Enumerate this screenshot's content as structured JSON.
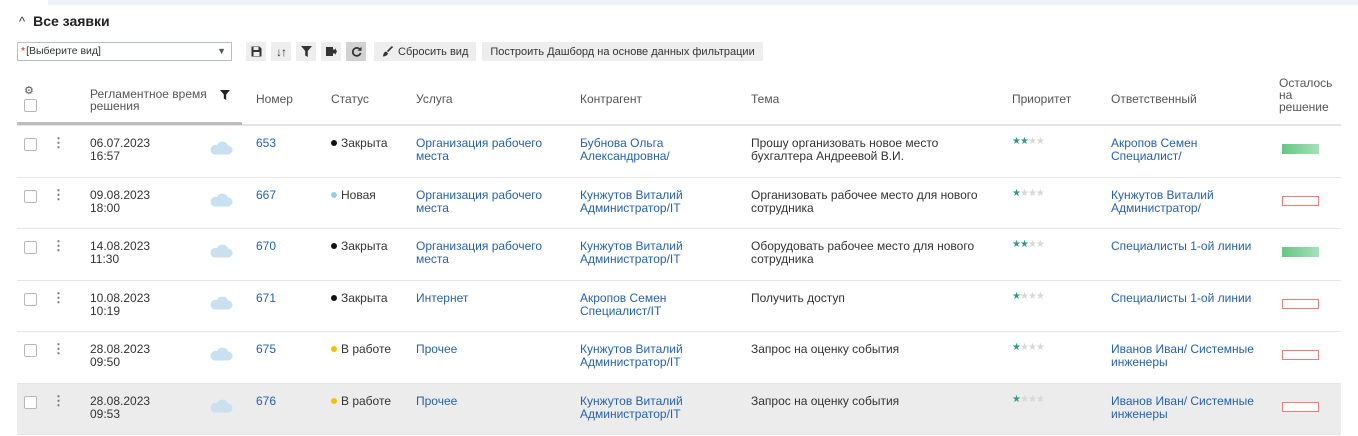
{
  "section": {
    "title": "Все заявки",
    "collapse_icon": "chevron-up"
  },
  "toolbar": {
    "view_select": {
      "required_mark": "*",
      "value": "[Выберите вид]"
    },
    "icons": [
      "save-icon",
      "sort-icon",
      "filter-icon",
      "export-icon",
      "refresh-icon"
    ],
    "reset_view_label": "Сбросить вид",
    "dashboard_label": "Построить Дашборд на основе данных фильтрации"
  },
  "columns": {
    "settings_icon": "gear-icon",
    "deadline": "Регламентное время решения",
    "number": "Номер",
    "status": "Статус",
    "service": "Услуга",
    "counterparty": "Контрагент",
    "subject": "Тема",
    "priority": "Приоритет",
    "responsible": "Ответственный",
    "remaining": "Осталось на решение"
  },
  "rows": [
    {
      "date": "06.07.2023",
      "time": "16:57",
      "number": "653",
      "status": "Закрыта",
      "status_color": "#111111",
      "service": "Организация рабочего места",
      "counterparty": "Бубнова Ольга Александровна/",
      "subject": "Прошу организовать новое место бухгалтера Андреевой В.И.",
      "priority": 2,
      "responsible": "Акропов Семен Специалист/",
      "remaining": "ok"
    },
    {
      "date": "09.08.2023",
      "time": "18:00",
      "number": "667",
      "status": "Новая",
      "status_color": "#9ccde6",
      "service": "Организация рабочего места",
      "counterparty": "Кунжутов Виталий Администратор/IT",
      "subject": "Организовать рабочее место для нового сотрудника",
      "priority": 1,
      "responsible": "Кунжутов Виталий Администратор/",
      "remaining": "overdue"
    },
    {
      "date": "14.08.2023",
      "time": "11:30",
      "number": "670",
      "status": "Закрыта",
      "status_color": "#111111",
      "service": "Организация рабочего места",
      "counterparty": "Кунжутов Виталий Администратор/IT",
      "subject": "Оборудовать рабочее место для нового сотрудника",
      "priority": 2,
      "responsible": "Специалисты 1-ой линии",
      "remaining": "ok"
    },
    {
      "date": "10.08.2023",
      "time": "10:19",
      "number": "671",
      "status": "Закрыта",
      "status_color": "#111111",
      "service": "Интернет",
      "counterparty": "Акропов Семен Специалист/IT",
      "subject": "Получить доступ",
      "priority": 1,
      "responsible": "Специалисты 1-ой линии",
      "remaining": "overdue"
    },
    {
      "date": "28.08.2023",
      "time": "09:50",
      "number": "675",
      "status": "В работе",
      "status_color": "#f2c200",
      "service": "Прочее",
      "counterparty": "Кунжутов Виталий Администратор/IT",
      "subject": "Запрос на оценку события",
      "priority": 1,
      "responsible": "Иванов Иван/ Системные инженеры",
      "remaining": "overdue"
    },
    {
      "date": "28.08.2023",
      "time": "09:53",
      "number": "676",
      "status": "В работе",
      "status_color": "#f2c200",
      "service": "Прочее",
      "counterparty": "Кунжутов Виталий Администратор/IT",
      "subject": "Запрос на оценку события",
      "priority": 1,
      "responsible": "Иванов Иван/ Системные инженеры",
      "remaining": "overdue",
      "highlighted": true
    }
  ]
}
